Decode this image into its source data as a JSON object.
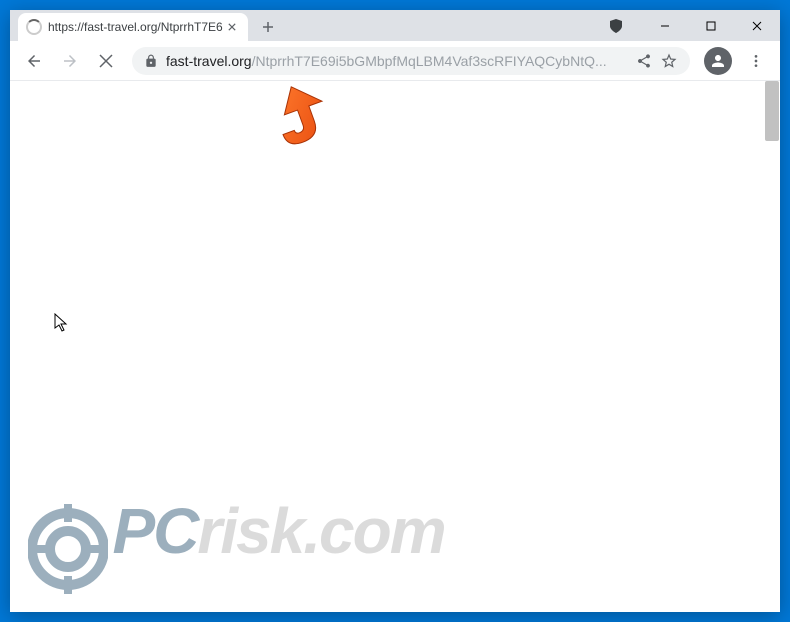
{
  "window": {
    "minimize": "–",
    "maximize": "☐",
    "close": "✕"
  },
  "tab": {
    "title": "https://fast-travel.org/NtprrhT7E6",
    "close_label": "✕"
  },
  "toolbar": {
    "new_tab_label": "+"
  },
  "url": {
    "domain": "fast-travel.org",
    "path": "/NtprrhT7E69i5bGMbpfMqLBM4Vaf3scRFIYAQCybNtQ..."
  },
  "watermark": {
    "prefix": "PC",
    "suffix": "risk.com"
  }
}
